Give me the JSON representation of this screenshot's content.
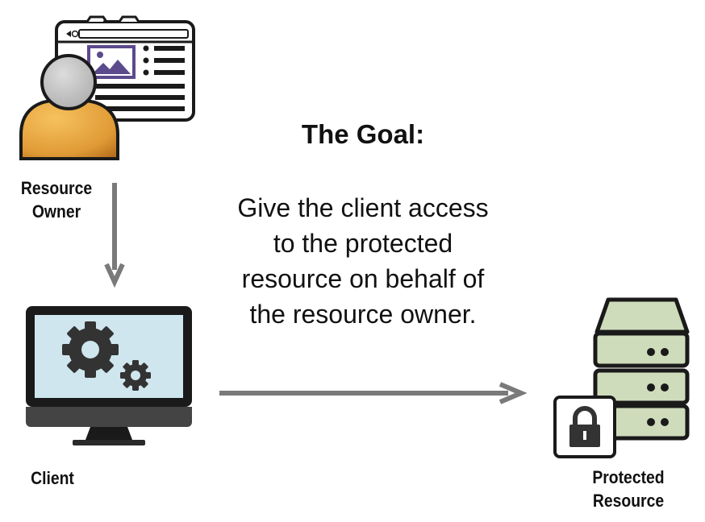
{
  "goal": {
    "title": "The Goal:",
    "lines": [
      "Give the client access",
      "to the protected",
      "resource on behalf of",
      "the resource owner."
    ]
  },
  "actors": {
    "resource_owner": {
      "line1": "Resource",
      "line2": "Owner",
      "icon": "user-with-browser-icon"
    },
    "client": {
      "label": "Client",
      "icon": "monitor-gears-icon"
    },
    "protected_resource": {
      "line1": "Protected",
      "line2": "Resource",
      "icon": "server-lock-icon"
    }
  },
  "colors": {
    "arrow": "#7a7a7a",
    "person": "#e8a540",
    "head": "#c8c8c8",
    "screen": "#cfe6ee",
    "server_green": "#cfdcbc",
    "image_purple": "#5b4a8c"
  }
}
